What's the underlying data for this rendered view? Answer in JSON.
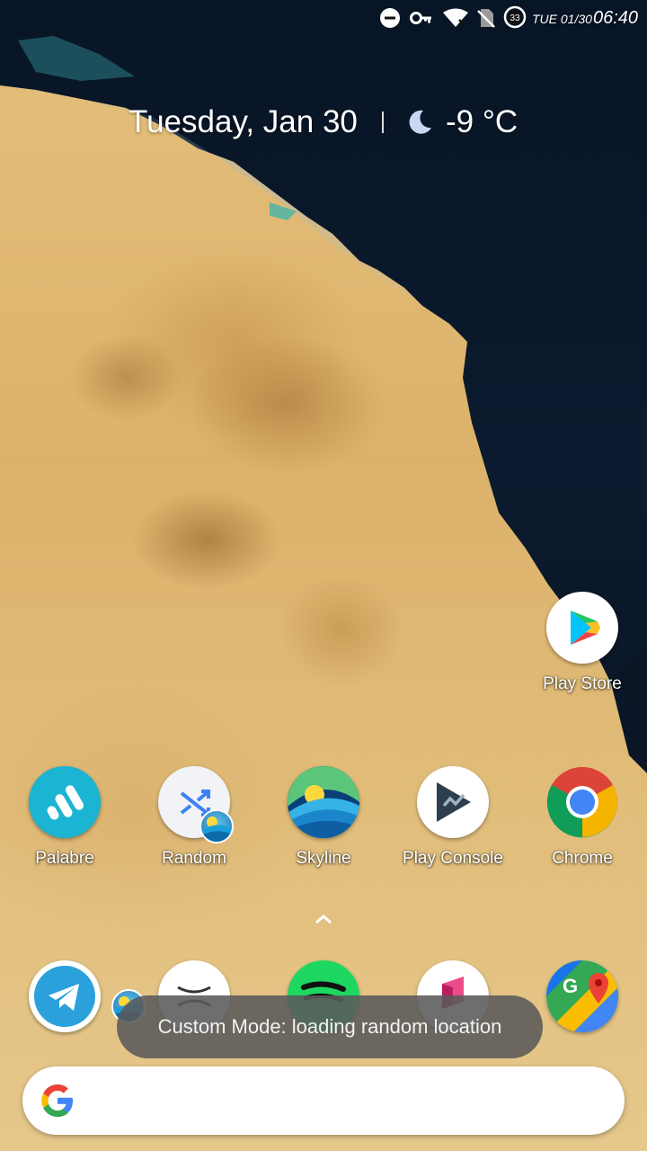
{
  "status_bar": {
    "date": "TUE 01/30",
    "time": "06:40",
    "data_saver_badge": "33",
    "icons": [
      "do-not-disturb-icon",
      "vpn-key-icon",
      "wifi-icon",
      "no-sim-icon",
      "data-saver-icon"
    ]
  },
  "widget": {
    "date": "Tuesday, Jan 30",
    "weather_icon": "moon-icon",
    "temperature": "-9 °C"
  },
  "apps_top": [
    {
      "label": "Play Store",
      "icon": "play-store-icon"
    }
  ],
  "apps_row": [
    {
      "label": "Palabre",
      "icon": "palabre-icon"
    },
    {
      "label": "Random",
      "icon": "random-shuffle-icon"
    },
    {
      "label": "Skyline",
      "icon": "skyline-icon"
    },
    {
      "label": "Play Console",
      "icon": "play-console-icon"
    },
    {
      "label": "Chrome",
      "icon": "chrome-icon"
    }
  ],
  "dock": [
    {
      "icon": "telegram-icon"
    },
    {
      "icon": "x-app-icon"
    },
    {
      "icon": "spotify-icon"
    },
    {
      "icon": "pink-app-icon"
    },
    {
      "icon": "google-maps-icon"
    }
  ],
  "toast": {
    "message": "Custom Mode: loading random location"
  },
  "search": {
    "icon": "google-g-icon"
  }
}
